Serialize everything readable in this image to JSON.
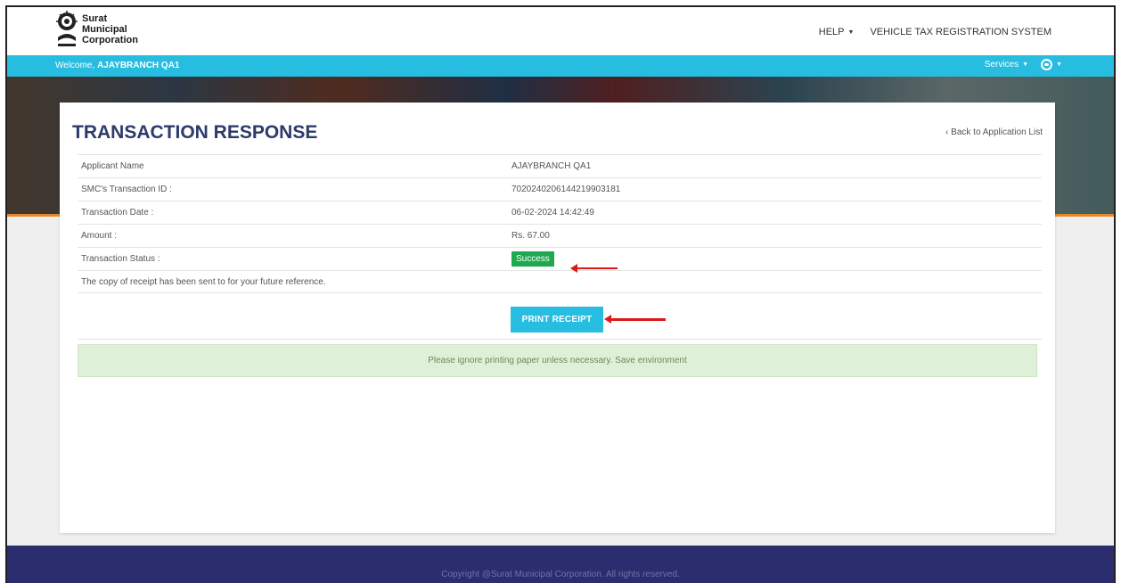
{
  "header": {
    "logo_line1": "Surat",
    "logo_line2": "Municipal",
    "logo_line3": "Corporation",
    "help_label": "HELP",
    "system_label": "VEHICLE TAX REGISTRATION SYSTEM"
  },
  "subbar": {
    "welcome_prefix": "Welcome,",
    "user_name": "AJAYBRANCH QA1",
    "services_label": "Services"
  },
  "card": {
    "title": "TRANSACTION RESPONSE",
    "back_link": "‹ Back to Application List",
    "rows": [
      {
        "label": "Applicant Name",
        "value": "AJAYBRANCH QA1"
      },
      {
        "label": "SMC's Transaction ID :",
        "value": "70202402061442199031​81"
      },
      {
        "label": "Transaction Date :",
        "value": "06-02-2024 14:42:49"
      },
      {
        "label": "Amount :",
        "value": "Rs. 67.00"
      },
      {
        "label": "Transaction Status :",
        "value": "Success"
      }
    ],
    "note": "The copy of receipt has been sent to for your future reference.",
    "print_button": "PRINT RECEIPT",
    "alert": "Please ignore printing paper unless necessary. Save environment"
  },
  "footer": {
    "copyright": "Copyright @Surat Municipal Corporation. All rights reserved."
  },
  "colors": {
    "accent": "#27bde0",
    "title": "#2d3a6b",
    "success": "#1fa84f",
    "footer_bg": "#2b2d6e",
    "annotation_arrow": "#e01818"
  },
  "icons": {
    "user": "user-circle-icon",
    "dropdown": "chevron-down-icon",
    "logo": "smc-emblem-icon"
  }
}
